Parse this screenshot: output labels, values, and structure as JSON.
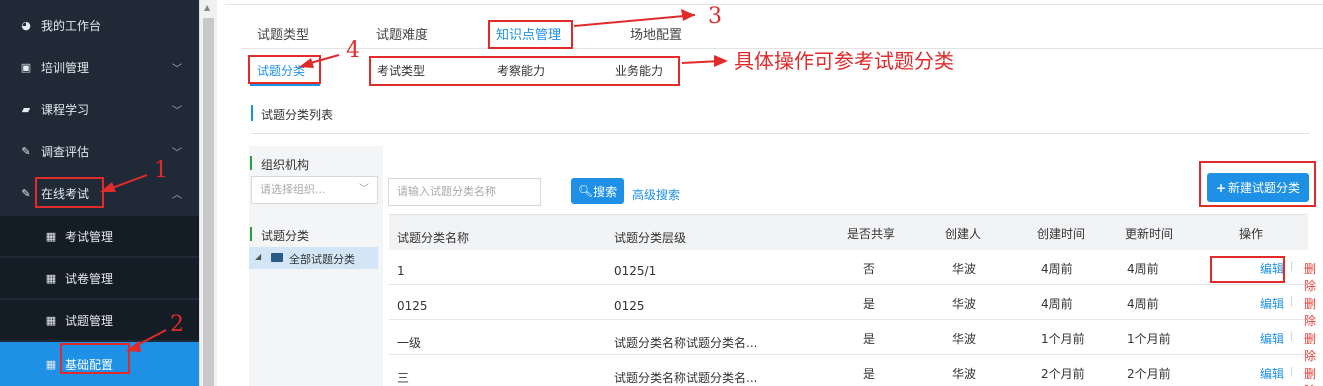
{
  "sidebar": {
    "items": [
      {
        "label": "我的工作台",
        "icon": "dashboard-icon",
        "chevron": ""
      },
      {
        "label": "培训管理",
        "icon": "training-icon",
        "chevron": "﹀"
      },
      {
        "label": "课程学习",
        "icon": "book-icon",
        "chevron": "﹀"
      },
      {
        "label": "调查评估",
        "icon": "pen-icon",
        "chevron": "﹀"
      },
      {
        "label": "在线考试",
        "icon": "pen-icon",
        "chevron": "︿"
      }
    ],
    "subitems": [
      {
        "label": "考试管理",
        "icon": "calendar-icon"
      },
      {
        "label": "试卷管理",
        "icon": "calendar-icon"
      },
      {
        "label": "试题管理",
        "icon": "calendar-icon"
      },
      {
        "label": "基础配置",
        "icon": "calendar-icon",
        "active": true
      }
    ]
  },
  "tabs_level1": [
    "试题类型",
    "试题难度",
    "知识点管理",
    "场地配置"
  ],
  "tabs_level1_active": 2,
  "tabs_level2": [
    "试题分类",
    "考试类型",
    "考察能力",
    "业务能力"
  ],
  "tabs_level2_active": 0,
  "section_title": "试题分类列表",
  "left_panel": {
    "org_label": "组织机构",
    "org_placeholder": "请选择组织...",
    "category_label": "试题分类",
    "tree_root": "全部试题分类"
  },
  "search": {
    "placeholder": "请输入试题分类名称",
    "button": "搜索",
    "advanced": "高级搜索"
  },
  "new_button": "新建试题分类",
  "table": {
    "headers": [
      "试题分类名称",
      "试题分类层级",
      "是否共享",
      "创建人",
      "创建时间",
      "更新时间",
      "操作"
    ],
    "rows": [
      [
        "1",
        "0125/1",
        "否",
        "华波",
        "4周前",
        "4周前"
      ],
      [
        "0125",
        "0125",
        "是",
        "华波",
        "4周前",
        "4周前"
      ],
      [
        "一级",
        "试题分类名称试题分类名...",
        "是",
        "华波",
        "1个月前",
        "1个月前"
      ],
      [
        "三",
        "试题分类名称试题分类名...",
        "是",
        "华波",
        "2个月前",
        "2个月前"
      ]
    ],
    "edit_label": "编辑",
    "delete_label": "删除",
    "separator": "|"
  },
  "annotations": {
    "num1": "1",
    "num2": "2",
    "num3": "3",
    "num4": "4",
    "note": "具体操作可参考试题分类",
    "color": "#e12a2a"
  },
  "colors": {
    "accent": "#1e90e6",
    "sidebar_bg": "#1f2a36",
    "danger": "#e2403a"
  }
}
